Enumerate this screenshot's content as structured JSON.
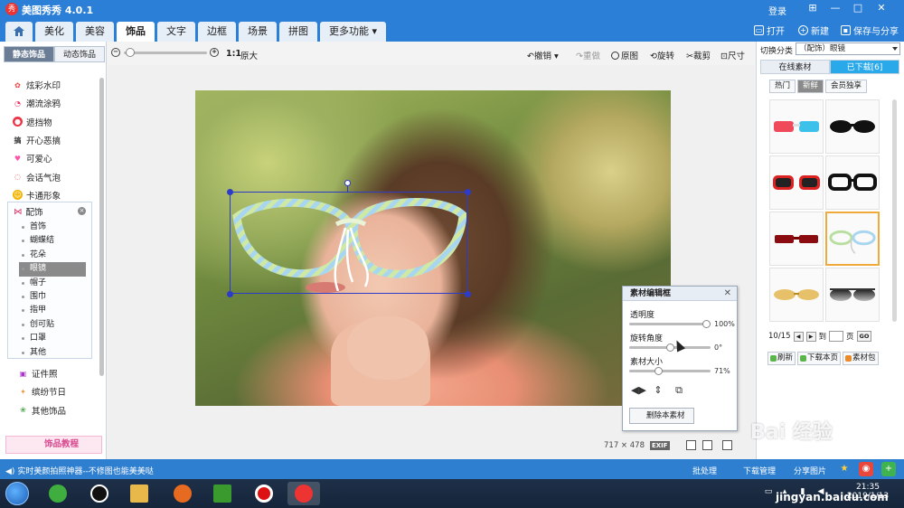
{
  "app": {
    "title": "美图秀秀 4.0.1",
    "logo": "秀",
    "login": "登录"
  },
  "window_controls": [
    "⊞",
    "—",
    "□",
    "✕"
  ],
  "main_tabs": [
    "美化",
    "美容",
    "饰品",
    "文字",
    "边框",
    "场景",
    "拼图",
    "更多功能"
  ],
  "top_actions": {
    "open": "打开",
    "new": "新建",
    "save": "保存与分享"
  },
  "left_panel": {
    "tabs": [
      "静态饰品",
      "动态饰品"
    ],
    "categories": [
      "炫彩水印",
      "潮流涂鸦",
      "遮挡物",
      "开心恶搞",
      "可爱心",
      "会话气泡",
      "卡通形象"
    ],
    "submenu_title": "配饰",
    "submenu_items": [
      "首饰",
      "蝴蝶结",
      "花朵",
      "眼镜",
      "帽子",
      "围巾",
      "指甲",
      "创可贴",
      "口罩",
      "其他"
    ],
    "categories_bottom": [
      "证件照",
      "缤纷节日",
      "其他饰品"
    ],
    "tutorial": "饰品教程"
  },
  "toolbar": {
    "ratio": "1:1",
    "original_size": "原大",
    "undo": "撤销",
    "redo": "重做",
    "original": "原图",
    "rotate": "旋转",
    "crop": "裁剪",
    "resize": "尺寸"
  },
  "editor": {
    "title": "素材编辑框",
    "opacity_label": "透明度",
    "opacity_value": "100%",
    "opacity": 1.0,
    "rotation_label": "旋转角度",
    "rotation_value": "0°",
    "rotation": 0.5,
    "size_label": "素材大小",
    "size_value": "71%",
    "size": 0.35,
    "delete": "删除本素材"
  },
  "canvas_info": {
    "dims": "717 × 478",
    "exif": "EXIF"
  },
  "right_panel": {
    "category_label": "切换分类",
    "category_value": "（配饰）眼镜",
    "tabs": [
      "在线素材",
      "已下载[6]"
    ],
    "filters": [
      "热门",
      "新鲜",
      "会员独享"
    ],
    "page": "10/15",
    "goto_label": "到",
    "page_unit": "页",
    "go": "GO",
    "refresh": "刷新",
    "download_page": "下载本页",
    "library": "素材包"
  },
  "status": {
    "text": "实时美颜拍照神器--不修图也能美美哒",
    "batch": "批处理",
    "download_manager": "下载管理",
    "share": "分享图片"
  },
  "taskbar": {
    "time": "21:35",
    "date": "2019/1/13"
  },
  "watermark": {
    "text": "Bai 经验",
    "url": "jingyan.baidu.com"
  },
  "colors": {
    "accent": "#2b7fd6",
    "selection": "#2c3cc9",
    "selected_thumb": "#f0a93b",
    "tab_blue": "#29a8ea"
  }
}
